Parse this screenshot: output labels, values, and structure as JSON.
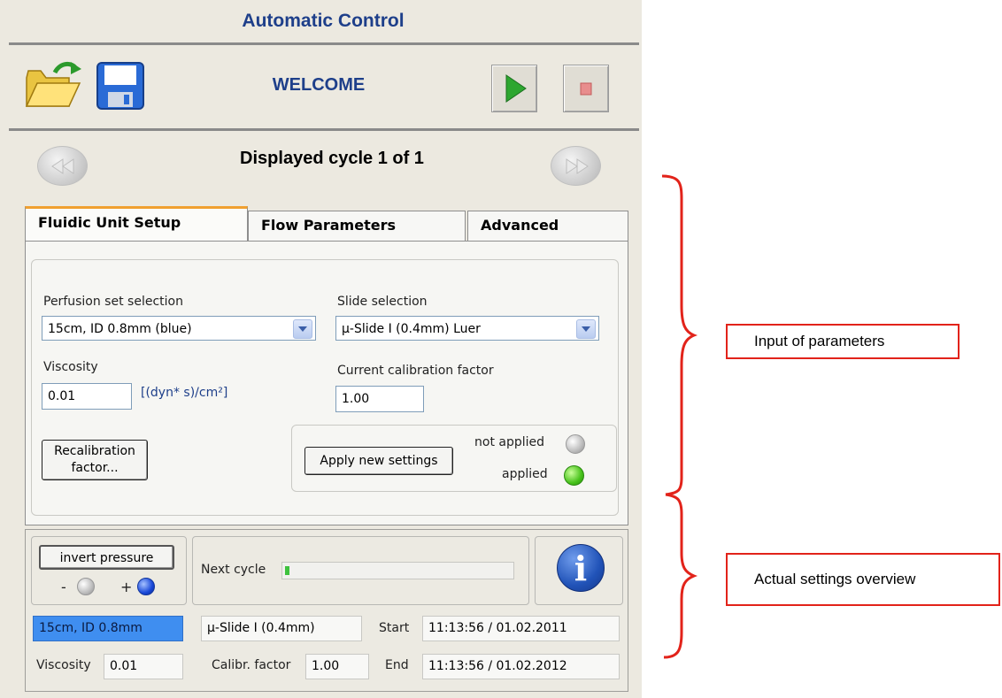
{
  "window_title": "Automatic Control",
  "toolbar": {
    "welcome": "WELCOME"
  },
  "cycle": {
    "label": "Displayed cycle 1 of 1"
  },
  "tabs": [
    "Fluidic Unit Setup",
    "Flow Parameters",
    "Advanced"
  ],
  "setup": {
    "perfusion_label": "Perfusion set selection",
    "perfusion_value": "15cm, ID 0.8mm (blue)",
    "slide_label": "Slide selection",
    "slide_value": "μ-Slide I (0.4mm) Luer",
    "viscosity_label": "Viscosity",
    "viscosity_value": "0.01",
    "viscosity_unit": "[(dyn* s)/cm²]",
    "calib_label": "Current calibration factor",
    "calib_value": "1.00",
    "recalib_button_line1": "Recalibration",
    "recalib_button_line2": "factor...",
    "apply_button": "Apply new settings",
    "not_applied": "not applied",
    "applied": "applied"
  },
  "overview": {
    "invert_button": "invert pressure",
    "minus": "-",
    "plus": "+",
    "next_cycle": "Next cycle",
    "next_cycle_progress": 0.02,
    "perfusion": "15cm, ID 0.8mm",
    "slide": "μ-Slide I (0.4mm)",
    "start_label": "Start",
    "start_value": "11:13:56 / 01.02.2011",
    "viscosity_label": "Viscosity",
    "viscosity_value": "0.01",
    "calib_label": "Calibr. factor",
    "calib_value": "1.00",
    "end_label": "End",
    "end_value": "11:13:56 / 01.02.2012",
    "info_glyph": "i"
  },
  "annotations": {
    "input": "Input of parameters",
    "overview": "Actual settings overview"
  },
  "colors": {
    "title": "#1e3f8a",
    "annotation": "#e2231a",
    "selection": "#3f8ef0"
  }
}
